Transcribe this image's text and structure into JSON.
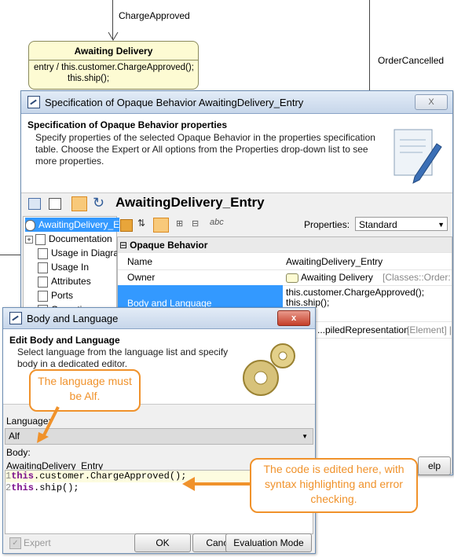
{
  "diagram": {
    "transition_top": "ChargeApproved",
    "transition_right": "OrderCancelled",
    "state_name": "Awaiting Delivery",
    "state_entry_line1": "entry / this.customer.ChargeApproved();",
    "state_entry_line2": "this.ship();"
  },
  "spec_window": {
    "title": "Specification of Opaque Behavior AwaitingDelivery_Entry",
    "close_label": "X",
    "header_title": "Specification of Opaque Behavior properties",
    "header_text": "Specify properties of the selected Opaque Behavior in the properties specification table. Choose the Expert or All options from the Properties drop-down list to see more properties.",
    "element_name": "AwaitingDelivery_Entry",
    "properties_label": "Properties:",
    "properties_value": "Standard",
    "tree_items": [
      "AwaitingDelivery_E",
      "Documentation",
      "Usage in Diagra",
      "Usage In",
      "Attributes",
      "Ports",
      "Operations"
    ],
    "group_label": "Opaque Behavior",
    "prop_rows": [
      {
        "name": "Name",
        "value": "AwaitingDelivery_Entry"
      },
      {
        "name": "Owner",
        "value": "Awaiting Delivery",
        "value_extra": "[Classes::Order::Or..."
      },
      {
        "name": "Body and Language",
        "value_line1": "this.customer.ChargeApproved();",
        "value_line2": "this.ship();"
      },
      {
        "name": "",
        "value": "...piledRepresentation",
        "value_extra": "[Element] [Acti"
      }
    ],
    "help_label": "elp"
  },
  "body_dialog": {
    "title": "Body and Language",
    "close_label": "x",
    "header_title": "Edit Body and Language",
    "header_text": "Select language from the language list and specify body in a dedicated editor.",
    "language_label": "Language:",
    "language_value": "Alf",
    "body_label": "Body:",
    "body_name": "AwaitingDelivery_Entry",
    "code_lines": [
      {
        "num": "1",
        "kw": "this",
        "rest": ".customer.ChargeApproved();"
      },
      {
        "num": "2",
        "kw": "this",
        "rest": ".ship();"
      }
    ],
    "expert_label": "Expert",
    "ok_label": "OK",
    "cancel_label": "Cancel",
    "eval_label": "Evaluation Mode"
  },
  "callouts": {
    "language": "The language must be Alf.",
    "code": "The code is edited here, with syntax highlighting and error checking."
  },
  "colors": {
    "accent_orange": "#f0922b",
    "selection_blue": "#3399ff",
    "keyword_purple": "#7a0d8a"
  }
}
